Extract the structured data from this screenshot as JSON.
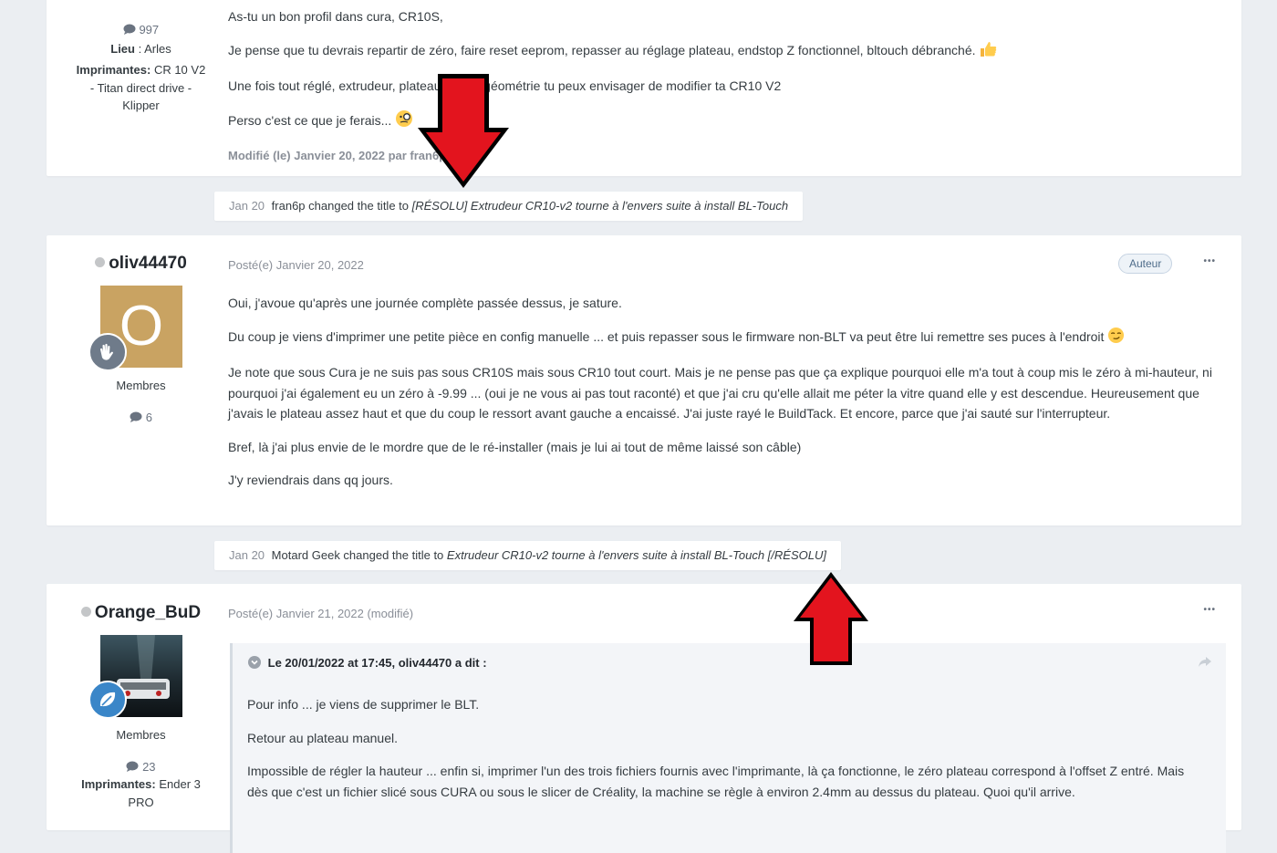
{
  "post1": {
    "post_count": "997",
    "location_label": "Lieu",
    "location_value": "Arles",
    "printers_label": "Imprimantes:",
    "printers_value": "CR 10 V2 - Titan direct drive - Klipper",
    "paragraphs": [
      "As-tu un bon profil dans cura, CR10S,",
      "Je pense que tu devrais repartir de zéro, faire reset eeprom, repasser au réglage plateau, endstop Z fonctionnel, bltouch débranché.",
      "Une fois tout réglé, extrudeur, plateau et tout géométrie tu peux envisager de modifier ta CR10 V2",
      "Perso c'est ce que je ferais..."
    ],
    "edited": "Modifié (le) Janvier 20, 2022 par fran6p"
  },
  "event1": {
    "date": "Jan 20",
    "text": "fran6p changed the title to",
    "title": "[RÉSOLU] Extrudeur CR10-v2 tourne à l'envers suite à install BL-Touch"
  },
  "post2": {
    "username": "oliv44470",
    "avatar_letter": "O",
    "group": "Membres",
    "post_count": "6",
    "date": "Posté(e) Janvier 20, 2022",
    "badge": "Auteur",
    "more": "•••",
    "paragraphs": [
      "Oui, j'avoue qu'après une journée complète passée dessus, je sature.",
      "Du coup je viens d'imprimer une petite pièce en config manuelle ... et puis repasser sous le firmware non-BLT va peut être lui remettre ses puces à l'endroit",
      "Je note que sous Cura je ne suis pas sous CR10S mais sous CR10 tout court. Mais je ne pense pas que ça explique pourquoi elle m'a tout à coup mis le zéro à mi-hauteur, ni pourquoi j'ai également eu un zéro à -9.99 ... (oui je ne vous ai pas tout raconté) et que j'ai cru qu'elle allait me péter la vitre quand elle y est descendue. Heureusement que j'avais le plateau assez haut et que du coup le ressort avant gauche a encaissé. J'ai juste rayé le BuildTack. Et encore, parce que j'ai sauté sur l'interrupteur.",
      "Bref, là j'ai plus envie de le mordre que de le ré-installer (mais je lui ai tout de même laissé son câble)",
      "J'y reviendrais dans qq jours."
    ]
  },
  "event2": {
    "date": "Jan 20",
    "text": "Motard Geek changed the title to",
    "title": "Extrudeur CR10-v2 tourne à l'envers suite à install BL-Touch [/RÉSOLU]"
  },
  "post3": {
    "username": "Orange_BuD",
    "group": "Membres",
    "post_count": "23",
    "printers_label": "Imprimantes:",
    "printers_value": "Ender 3 PRO",
    "date": "Posté(e) Janvier 21, 2022 (modifié)",
    "more": "•••",
    "quote_header": "Le 20/01/2022 at 17:45, oliv44470 a dit :",
    "quote_paragraphs": [
      "Pour info ... je viens de supprimer le BLT.",
      "Retour au plateau manuel.",
      "Impossible de régler la hauteur ... enfin si, imprimer l'un des trois fichiers fournis avec l'imprimante, là ça fonctionne, le zéro plateau correspond à l'offset Z entré. Mais dès que c'est un fichier slicé sous CURA ou sous le slicer de Créality, la machine se règle à environ 2.4mm au dessus du plateau. Quoi qu'il arrive."
    ]
  },
  "colors": {
    "background": "#ebeef2",
    "card": "#ffffff",
    "arrow": "#e3141e",
    "avatar_o": "#c9a362",
    "rank_badge": "#6f7b8a",
    "rank_badge2": "#3a86c8"
  },
  "icons": [
    "comment-icon",
    "hand-wave-icon",
    "leaf-icon",
    "chevron-down-circle-icon",
    "share-icon",
    "thumbs-up-emoji",
    "monocle-emoji",
    "smirk-emoji",
    "down-arrow-annotation",
    "up-arrow-annotation"
  ]
}
